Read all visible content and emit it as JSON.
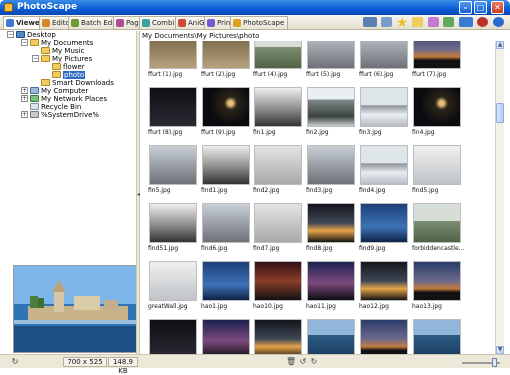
{
  "window": {
    "title": "PhotoScape"
  },
  "tabs": [
    {
      "label": "Viewer",
      "color": "#3a7bd5",
      "active": true
    },
    {
      "label": "Editor",
      "color": "#d48a2a"
    },
    {
      "label": "Batch Editor",
      "color": "#6a9a3a"
    },
    {
      "label": "Page",
      "color": "#b24a9a"
    },
    {
      "label": "Combine",
      "color": "#3aa0a0"
    },
    {
      "label": "AniGif",
      "color": "#d04a3a"
    },
    {
      "label": "Print",
      "color": "#7a5ad0"
    },
    {
      "label": "PhotoScape",
      "color": "#e0a020"
    }
  ],
  "toolbar_icons": [
    "slideshow-icon",
    "screen-icon",
    "star-icon",
    "folder-icon",
    "palette-icon",
    "arrow-icon",
    "donate-icon",
    "settings-icon",
    "help-icon"
  ],
  "tree": {
    "desktop": "Desktop",
    "my_documents": "My Documents",
    "my_music": "My Music",
    "my_pictures": "My Pictures",
    "flower": "flower",
    "photo": "photo",
    "smart_downloads": "Smart Downloads",
    "my_computer": "My Computer",
    "my_network": "My Network Places",
    "recycle_bin": "Recycle Bin",
    "system_drive": "%SystemDrive%"
  },
  "path": "My Documents\\My Pictures\\photo",
  "thumbnails": [
    "ffurt (1).jpg",
    "ffurt (2).jpg",
    "ffurt (4).jpg",
    "ffurt (5).jpg",
    "ffurt (6).jpg",
    "ffurt (7).jpg",
    "ffurt (8).jpg",
    "ffurt (9).jpg",
    "fin1.jpg",
    "fin2.jpg",
    "fin3.jpg",
    "fin4.jpg",
    "fin5.jpg",
    "find1.jpg",
    "find2.jpg",
    "find3.jpg",
    "find4.jpg",
    "find5.jpg",
    "find51.jpg",
    "find6.jpg",
    "find7.jpg",
    "find8.jpg",
    "find9.jpg",
    "forbiddencastle......",
    "greatWall.jpg",
    "hao1.jpg",
    "hao10.jpg",
    "hao11.jpg",
    "hao12.jpg",
    "hao13.jpg",
    "",
    "",
    "",
    "",
    "",
    ""
  ],
  "status": {
    "dimensions": "700 x 525",
    "size": "148.9 KB"
  }
}
